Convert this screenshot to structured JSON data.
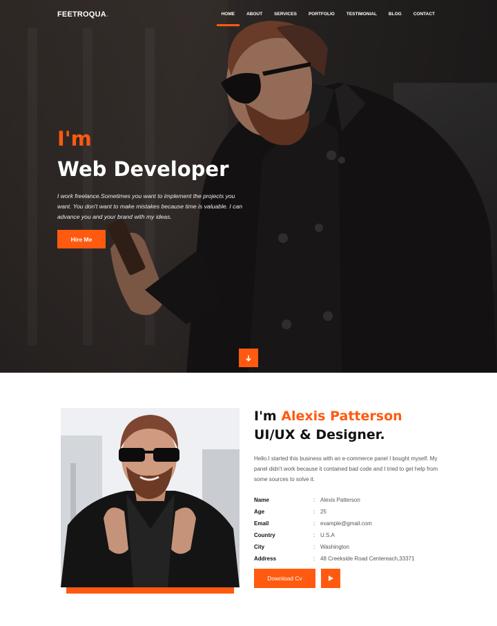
{
  "brand": {
    "name": "FEETROQUA",
    "dot": "."
  },
  "nav": {
    "items": [
      {
        "label": "HOME",
        "active": true
      },
      {
        "label": "ABOUT",
        "active": false
      },
      {
        "label": "SERVICES",
        "active": false
      },
      {
        "label": "PORTFOLIO",
        "active": false
      },
      {
        "label": "TESTIMONIAL",
        "active": false
      },
      {
        "label": "BLOG",
        "active": false
      },
      {
        "label": "CONTACT",
        "active": false
      }
    ]
  },
  "hero": {
    "intro": "I'm",
    "title": "Web Developer",
    "description": "I work freelance.Sometimes you want to implement the projects you want. You don't want to make mistakes because time is valuable. I can advance you and your brand with my ideas.",
    "hire_label": "Hire Me",
    "scroll_icon": "arrow-down-icon"
  },
  "about": {
    "intro": "I'm",
    "name": "Alexis Patterson",
    "role": "UI/UX & Designer.",
    "description": "Hello.I started this business with an e-commerce panel I bought myself. My panel didn't work because it contained bad code and I tried to get help from some sources to solve it.",
    "separator": ":",
    "details": [
      {
        "label": "Name",
        "value": "Alexis Patterson"
      },
      {
        "label": "Age",
        "value": "25"
      },
      {
        "label": "Email",
        "value": "example@gmail.com"
      },
      {
        "label": "Country",
        "value": "U.S.A"
      },
      {
        "label": "City",
        "value": "Washington"
      },
      {
        "label": "Address",
        "value": "48 Creekside Road Centereach,33371"
      }
    ],
    "download_label": "Download Cv",
    "play_icon": "play-icon"
  },
  "colors": {
    "accent": "#ff5a10",
    "heading": "#111111",
    "text": "#555555"
  }
}
